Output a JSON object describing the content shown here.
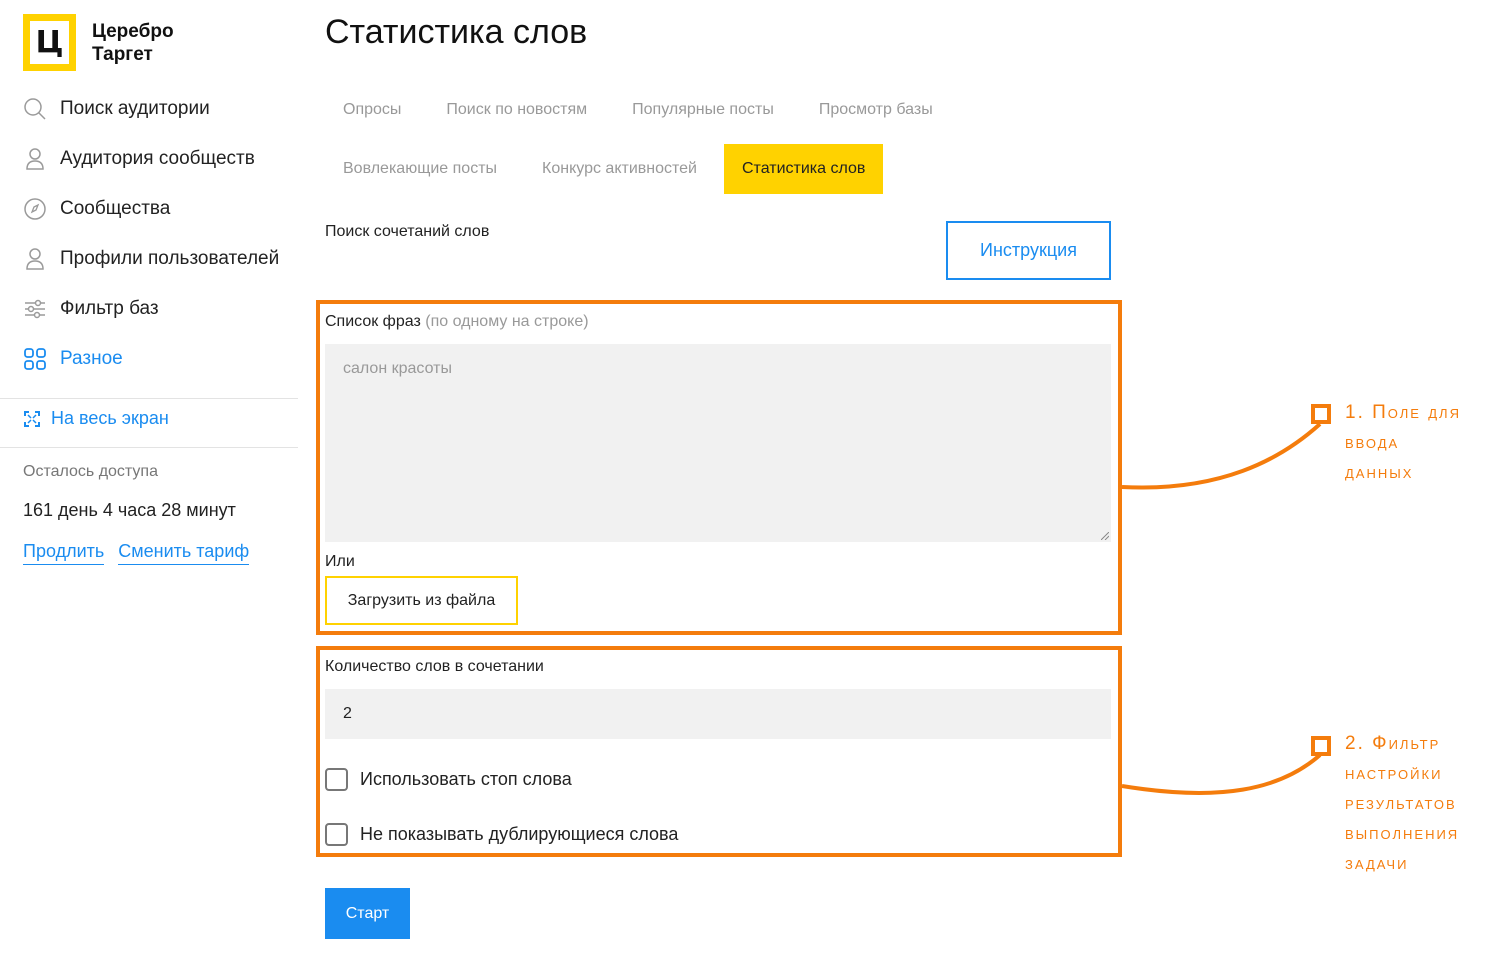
{
  "logo": {
    "mark": "Ц",
    "line1": "Церебро",
    "line2": "Таргет"
  },
  "sidebar": {
    "items": [
      {
        "label": "Поиск аудитории",
        "icon": "search-icon"
      },
      {
        "label": "Аудитория сообществ",
        "icon": "person-icon"
      },
      {
        "label": "Сообщества",
        "icon": "compass-icon"
      },
      {
        "label": "Профили пользователей",
        "icon": "person-icon"
      },
      {
        "label": "Фильтр баз",
        "icon": "sliders-icon"
      },
      {
        "label": "Разное",
        "icon": "grid-icon",
        "active": true
      }
    ],
    "fullscreen": "На весь экран",
    "access_label": "Осталось доступа",
    "access_value": "161 день 4 часа 28 минут",
    "extend": "Продлить",
    "change_plan": "Сменить тариф"
  },
  "main": {
    "title": "Статистика слов",
    "tabs_row1": [
      "Опросы",
      "Поиск по новостям",
      "Популярные посты",
      "Просмотр базы"
    ],
    "tabs_row2": [
      "Вовлекающие посты",
      "Конкурс активностей",
      "Статистика слов"
    ],
    "active_tab": "Статистика слов",
    "section_label": "Поиск сочетаний слов",
    "instruction_button": "Инструкция",
    "phrases_label": "Список фраз",
    "phrases_hint": "(по одному на строке)",
    "phrases_placeholder": "салон красоты",
    "or_label": "Или",
    "upload_button": "Загрузить из файла",
    "word_count_label": "Количество слов в сочетании",
    "word_count_value": "2",
    "checkbox_stopwords": "Использовать стоп слова",
    "checkbox_duplicates": "Не показывать дублирующиеся слова",
    "start_button": "Старт"
  },
  "annotations": {
    "a1": [
      "1. Поле для",
      "ввода",
      "данных"
    ],
    "a2": [
      "2. Фильтр",
      "настройки",
      "результатов",
      "выполнения",
      "задачи"
    ]
  },
  "colors": {
    "accent_yellow": "#ffd200",
    "link_blue": "#1a8cf0",
    "annotation_orange": "#f47c0c"
  }
}
